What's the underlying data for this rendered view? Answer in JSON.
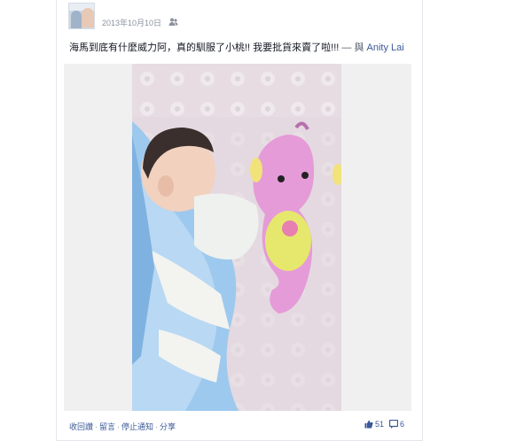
{
  "post": {
    "timestamp": "2013年10月10日",
    "status_text": "海馬到底有什麼威力阿，真的馴服了小桃!! 我要批貨來賣了啦!!!",
    "tag_sep": " — 與 ",
    "tagged_name": "Anity Lai",
    "audience_icon": "friends-icon"
  },
  "actions": {
    "unlike": "收回讚",
    "comment": "留言",
    "stop_notifications": "停止通知",
    "share": "分享",
    "separator": "·"
  },
  "counts": {
    "likes": "51",
    "comments": "6"
  },
  "colors": {
    "link": "#3b5998",
    "meta": "#8b929e",
    "seahorse": "#e59bd8",
    "blanket": "#9ec9ee"
  }
}
